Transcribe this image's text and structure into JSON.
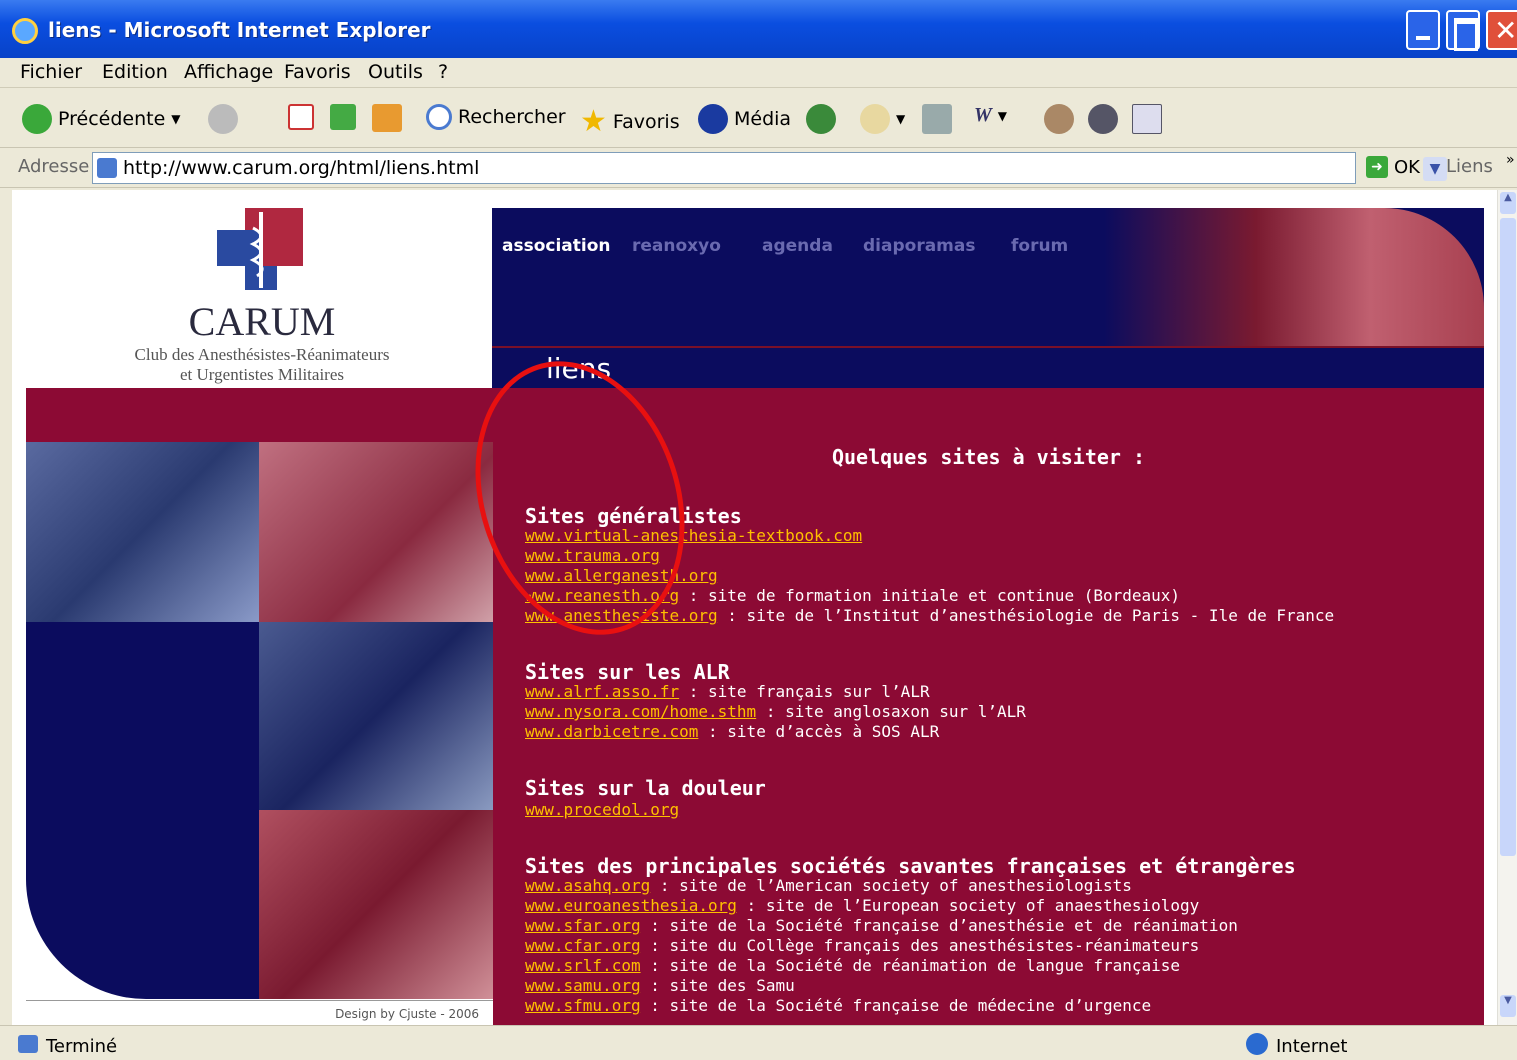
{
  "window": {
    "title": "liens - Microsoft Internet Explorer"
  },
  "menu": [
    "Fichier",
    "Edition",
    "Affichage",
    "Favoris",
    "Outils",
    "?"
  ],
  "toolbar": {
    "back": "Précédente",
    "search": "Rechercher",
    "favorites": "Favoris",
    "media": "Média"
  },
  "address": {
    "label": "Adresse",
    "url": "http://www.carum.org/html/liens.html",
    "go": "OK",
    "links": "Liens"
  },
  "site": {
    "brand": "CARUM",
    "subtitle_1": "Club des Anesthésistes-Réanimateurs",
    "subtitle_2": "et Urgentistes Militaires",
    "nav": [
      "association",
      "reanoxyo",
      "agenda",
      "diaporamas",
      "forum"
    ],
    "page_heading": "liens",
    "intro": "Quelques sites à visiter :",
    "credit": "Design by Cjuste - 2006"
  },
  "sections": [
    {
      "title": "Sites généralistes",
      "items": [
        {
          "link": "www.virtual-anesthesia-textbook.com",
          "desc": ""
        },
        {
          "link": "www.trauma.org",
          "desc": ""
        },
        {
          "link": "www.allerganesth.org",
          "desc": ""
        },
        {
          "link": "www.reanesth.org",
          "desc": " : site de formation initiale et continue (Bordeaux)"
        },
        {
          "link": "www.anesthesiste.org",
          "desc": " : site de l’Institut d’anesthésiologie de Paris - Ile de France"
        }
      ]
    },
    {
      "title": "Sites sur les ALR",
      "items": [
        {
          "link": "www.alrf.asso.fr",
          "desc": " : site français sur l’ALR"
        },
        {
          "link": "www.nysora.com/home.sthm",
          "desc": " : site anglosaxon sur l’ALR"
        },
        {
          "link": "www.darbicetre.com",
          "desc": " : site d’accès à SOS ALR"
        }
      ]
    },
    {
      "title": "Sites sur la douleur",
      "items": [
        {
          "link": "www.procedol.org",
          "desc": ""
        }
      ]
    },
    {
      "title": "Sites des principales sociétés savantes françaises et étrangères",
      "items": [
        {
          "link": "www.asahq.org",
          "desc": " : site de l’American society of anesthesiologists"
        },
        {
          "link": "www.euroanesthesia.org",
          "desc": " : site de l’European society of anaesthesiology"
        },
        {
          "link": "www.sfar.org",
          "desc": " : site de la Société française d’anesthésie et de réanimation"
        },
        {
          "link": "www.cfar.org",
          "desc": " : site du Collège français des anesthésistes-réanimateurs"
        },
        {
          "link": "www.srlf.com",
          "desc": " : site de la Société de réanimation de langue française"
        },
        {
          "link": "www.samu.org",
          "desc": " : site des Samu"
        },
        {
          "link": "www.sfmu.org",
          "desc": " : site de la Société française de médecine d’urgence"
        }
      ]
    }
  ],
  "status": {
    "left": "Terminé",
    "zone": "Internet"
  },
  "colors": {
    "navy": "#0b0c5e",
    "crimson": "#8c0a34",
    "link": "#ffc000",
    "annotation": "#e81010"
  }
}
